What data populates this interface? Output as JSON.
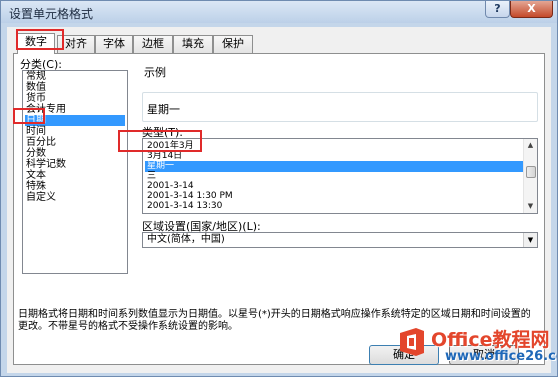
{
  "window": {
    "title": "设置单元格格式",
    "help_label": "?",
    "close_label": "X"
  },
  "tabs": [
    {
      "label": "数字",
      "active": true
    },
    {
      "label": "对齐",
      "active": false
    },
    {
      "label": "字体",
      "active": false
    },
    {
      "label": "边框",
      "active": false
    },
    {
      "label": "填充",
      "active": false
    },
    {
      "label": "保护",
      "active": false
    }
  ],
  "category": {
    "label": "分类(C):",
    "items": [
      "常规",
      "数值",
      "货币",
      "会计专用",
      "日期",
      "时间",
      "百分比",
      "分数",
      "科学记数",
      "文本",
      "特殊",
      "自定义"
    ],
    "selected": "日期"
  },
  "sample": {
    "label": "示例",
    "value": "星期一"
  },
  "type": {
    "label": "类型(T):",
    "items": [
      "2001年3月",
      "3月14日",
      "星期一",
      "三",
      "2001-3-14",
      "2001-3-14 1:30 PM",
      "2001-3-14 13:30"
    ],
    "selected": "星期一"
  },
  "locale": {
    "label": "区域设置(国家/地区)(L):",
    "value": "中文(简体，中国)"
  },
  "description": "日期格式将日期和时间系列数值显示为日期值。以星号(*)开头的日期格式响应操作系统特定的区域日期和时间设置的更改。不带星号的格式不受操作系统设置的影响。",
  "buttons": {
    "ok_label": "确定",
    "cancel_label": "取消"
  },
  "watermark": {
    "brand": "Office教程网",
    "url": "www.office26.com"
  },
  "colors": {
    "selection": "#3399ff",
    "annotation": "#e02a2a",
    "watermark_red": "#e3462c",
    "watermark_blue": "#1f68b8"
  }
}
